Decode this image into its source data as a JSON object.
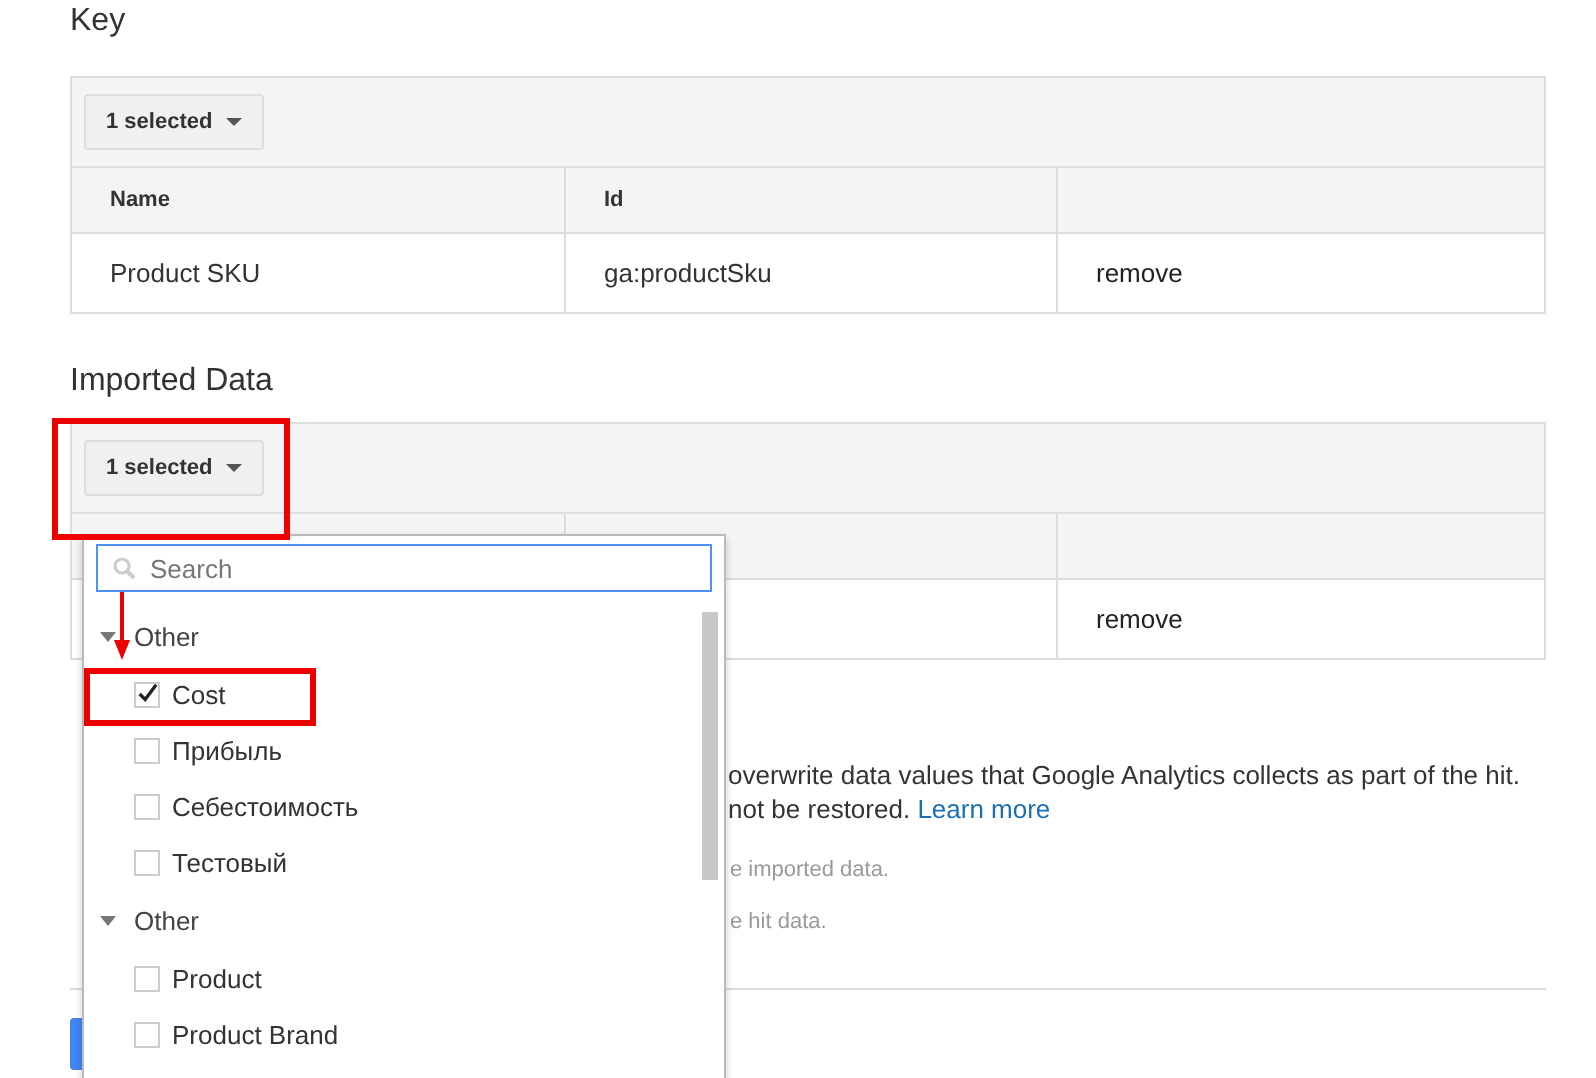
{
  "key_section": {
    "title": "Key",
    "toolbar_button": "1 selected",
    "columns": [
      "Name",
      "Id"
    ],
    "rows": [
      {
        "name": "Product SKU",
        "id": "ga:productSku",
        "action": "remove"
      }
    ]
  },
  "imported_section": {
    "title": "Imported Data",
    "toolbar_button": "1 selected",
    "rows": [
      {
        "action": "remove"
      }
    ]
  },
  "overwrite": {
    "line_1_end": "overwrite data values that Google Analytics collects as part of the hit.",
    "line_2_end": "not be restored.",
    "link": "Learn more",
    "option_1_fragment": "e imported data.",
    "option_2_fragment": "e hit data."
  },
  "dropdown": {
    "search": {
      "placeholder": "Search"
    },
    "groups": [
      {
        "label": "Other",
        "expanded": true,
        "items": [
          {
            "label": "Cost",
            "checked": true
          },
          {
            "label": "Прибыль",
            "checked": false
          },
          {
            "label": "Себестоимость",
            "checked": false
          },
          {
            "label": "Тестовый",
            "checked": false
          }
        ]
      },
      {
        "label": "Other",
        "expanded": true,
        "items": [
          {
            "label": "Product",
            "checked": false
          },
          {
            "label": "Product Brand",
            "checked": false
          }
        ]
      }
    ]
  }
}
